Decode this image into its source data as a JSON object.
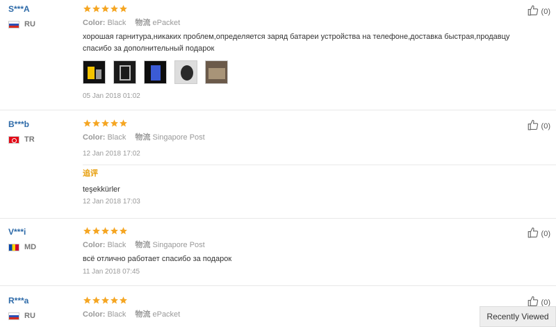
{
  "reviews": [
    {
      "user": "S***A",
      "country": "RU",
      "color_label": "Color:",
      "color_value": "Black",
      "shipping_label": "物流",
      "shipping_value": "ePacket",
      "text": "хорошая гарнитура,никаких проблем,определяется заряд батареи устройства на телефоне,доставка быстрая,продавцу спасибо за дополнительный подарок",
      "photo_count": 5,
      "date": "05 Jan 2018 01:02",
      "helpful": "(0)",
      "rating": 5
    },
    {
      "user": "B***b",
      "country": "TR",
      "color_label": "Color:",
      "color_value": "Black",
      "shipping_label": "物流",
      "shipping_value": "Singapore Post",
      "date": "12 Jan 2018 17:02",
      "append_title": "追评",
      "append_text": "teşekkürler",
      "append_date": "12 Jan 2018 17:03",
      "helpful": "(0)",
      "rating": 5
    },
    {
      "user": "V***i",
      "country": "MD",
      "color_label": "Color:",
      "color_value": "Black",
      "shipping_label": "物流",
      "shipping_value": "Singapore Post",
      "text": "всё отлично работает спасибо за подарок",
      "date": "11 Jan 2018 07:45",
      "helpful": "(0)",
      "rating": 5
    },
    {
      "user": "R***a",
      "country": "RU",
      "color_label": "Color:",
      "color_value": "Black",
      "shipping_label": "物流",
      "shipping_value": "ePacket",
      "helpful": "(0)",
      "rating": 5
    }
  ],
  "recently_viewed": "Recently Viewed",
  "colors": {
    "star": "#f5a623",
    "username": "#2d6aa8",
    "append": "#e69a00"
  }
}
